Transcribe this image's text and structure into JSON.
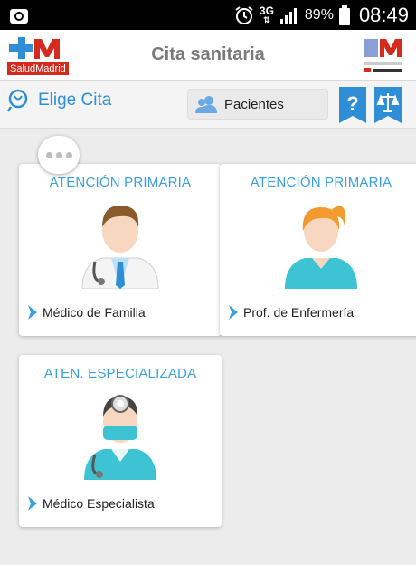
{
  "status_bar": {
    "network": "3G",
    "battery": "89%",
    "time": "08:49"
  },
  "header": {
    "logo_text": "SaludMadrid",
    "title": "Cita sanitaria"
  },
  "toolbar": {
    "elige_label": "Elige Cita",
    "pacientes_label": "Pacientes",
    "help_glyph": "?"
  },
  "colors": {
    "accent": "#2e8fd6",
    "card_title": "#3a9fe0",
    "brand_red": "#d52b1e"
  },
  "cards": [
    {
      "title": "ATENCIÓN PRIMARIA",
      "label": "Médico de Familia",
      "icon": "doctor-icon"
    },
    {
      "title": "ATENCIÓN PRIMARIA",
      "label": "Prof. de Enfermería",
      "icon": "nurse-icon"
    },
    {
      "title": "ATEN. ESPECIALIZADA",
      "label": "Médico Especialista",
      "icon": "specialist-icon"
    }
  ]
}
